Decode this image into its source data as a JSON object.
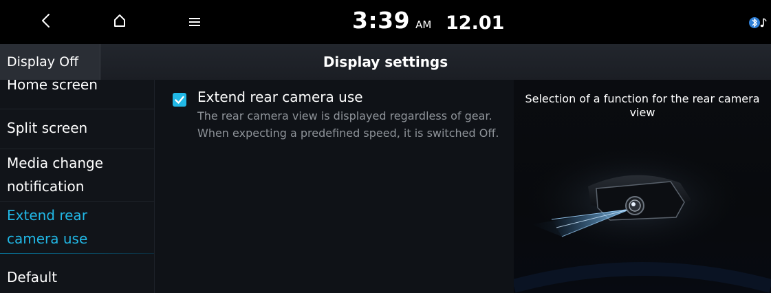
{
  "status_bar": {
    "time": "3:39",
    "ampm": "AM",
    "date": "12.01",
    "icons": [
      "back-icon",
      "home-icon",
      "menu-icon",
      "bluetooth-audio-icon"
    ]
  },
  "header": {
    "display_off_label": "Display Off",
    "title": "Display settings"
  },
  "sidebar": {
    "items": [
      {
        "label": "Home screen"
      },
      {
        "label": "Split screen"
      },
      {
        "label_line1": "Media change",
        "label_line2": "notification"
      },
      {
        "label_line1": "Extend rear",
        "label_line2": "camera use",
        "active": true
      },
      {
        "label": "Default"
      }
    ]
  },
  "option": {
    "title": "Extend rear camera use",
    "checked": true,
    "description": "The rear camera view is displayed regardless of gear. When expecting a predefined speed, it is switched Off."
  },
  "info_panel": {
    "text": "Selection of a function for the rear camera view",
    "image": "rear-camera-illustration"
  },
  "colors": {
    "accent": "#21b8e6",
    "background": "#0c0f14",
    "statusbar": "#000000",
    "secondary_text": "#8f949a"
  }
}
